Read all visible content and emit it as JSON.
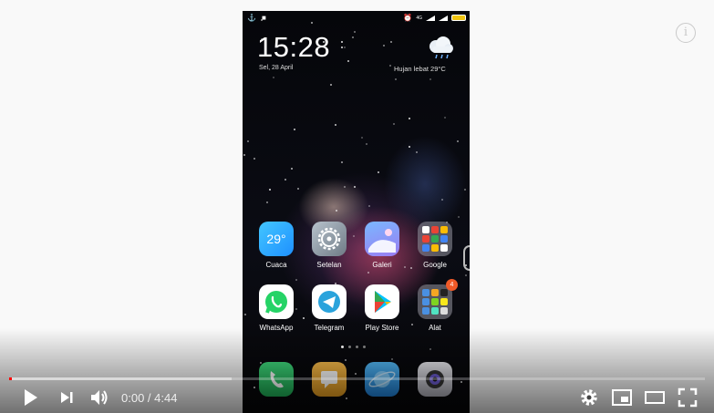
{
  "status_bar": {
    "icons": [
      "usb-icon",
      "video-record-icon",
      "alarm-icon",
      "signal-icon",
      "signal-icon",
      "battery-icon"
    ],
    "network": "4G"
  },
  "lockscreen": {
    "time": "15:28",
    "date": "Sel, 28 April",
    "weather_text": "Hujan lebat  29°C",
    "weather_icon": "rain-cloud-icon"
  },
  "apps": [
    {
      "label": "Cuaca",
      "icon": "weather-app-icon",
      "icon_text": "29°"
    },
    {
      "label": "Setelan",
      "icon": "settings-gear-icon"
    },
    {
      "label": "Galeri",
      "icon": "gallery-icon"
    },
    {
      "label": "Google",
      "icon": "google-folder-icon"
    },
    {
      "label": "WhatsApp",
      "icon": "whatsapp-icon"
    },
    {
      "label": "Telegram",
      "icon": "telegram-icon"
    },
    {
      "label": "Play Store",
      "icon": "play-store-icon"
    },
    {
      "label": "Alat",
      "icon": "tools-folder-icon",
      "badge": "4"
    }
  ],
  "dock": [
    "phone-icon",
    "messages-icon",
    "browser-icon",
    "camera-icon"
  ],
  "player": {
    "current_time": "0:00",
    "separator": " / ",
    "duration": "4:44",
    "progress_played": 0.004,
    "progress_loaded": 0.32,
    "accent": "#ff0000"
  }
}
